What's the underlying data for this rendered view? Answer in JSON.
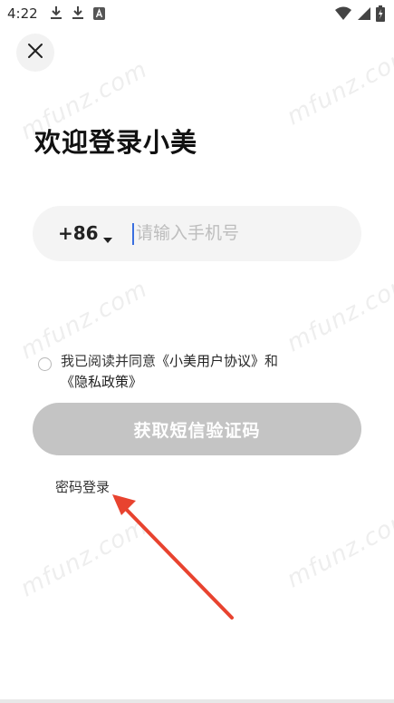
{
  "status_bar": {
    "time": "4:22",
    "left_icons": [
      "download-icon",
      "download-icon",
      "a-keyboard-icon"
    ],
    "right_icons": [
      "wifi-icon",
      "signal-icon",
      "battery-charging-icon"
    ]
  },
  "header": {
    "close_icon": "close-icon",
    "title": "欢迎登录小美"
  },
  "phone": {
    "country_code": "+86",
    "placeholder": "请输入手机号",
    "value": ""
  },
  "agreement": {
    "prefix": "我已阅读并同意",
    "user_agreement": "《小美用户协议》",
    "and": "和",
    "privacy_policy": "《隐私政策》"
  },
  "actions": {
    "get_sms_code": "获取短信验证码",
    "password_login": "密码登录"
  },
  "watermark": {
    "text": "mfunz.com"
  },
  "colors": {
    "button_disabled": "#c4c4c4",
    "input_bg": "#f4f4f4",
    "arrow": "#e8432f",
    "cursor": "#3a6fe0"
  }
}
